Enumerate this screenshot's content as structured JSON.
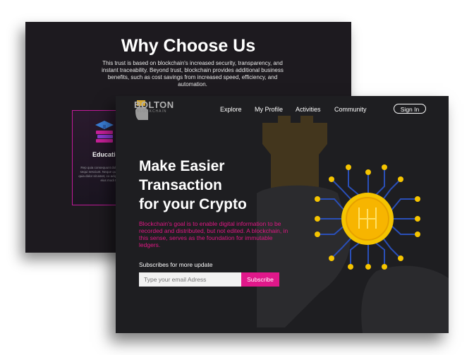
{
  "back_card": {
    "title": "Why Choose Us",
    "description": "This trust is based on blockchain's increased security, transparency, and instant traceability. Beyond trust, blockchain provides additional business benefits, such as cost savings from increased speed, efficiency, and automation.",
    "feature": {
      "title": "Educatio",
      "text": "Rep quia consequunt doloreq iste qui ratione sequi nesciunt. Neque quisquam est, qui dolo quia dolor sit amet, co adipisci velit, sed quia no eius modi tempo"
    }
  },
  "front_card": {
    "logo": {
      "name": "BOLTON",
      "sub": "BLOCKCHAIN"
    },
    "nav": [
      "Explore",
      "My Profile",
      "Activities",
      "Community"
    ],
    "signin_label": "Sign In",
    "hero": {
      "line1": "Make Easier",
      "line2": "Transaction",
      "line3": "for your Crypto",
      "description": "Blockchain's goal is to enable digital information to be recorded and distributed, but not edited. A blockchain, in this sense, serves as the foundation for immutable ledgers."
    },
    "subscribe": {
      "label": "Subscribes for more update",
      "placeholder": "Type your email Adress",
      "button": "Subscribe"
    }
  },
  "colors": {
    "accent": "#e0188a",
    "coin": "#f5c400",
    "circuit": "#2a4fb8"
  }
}
